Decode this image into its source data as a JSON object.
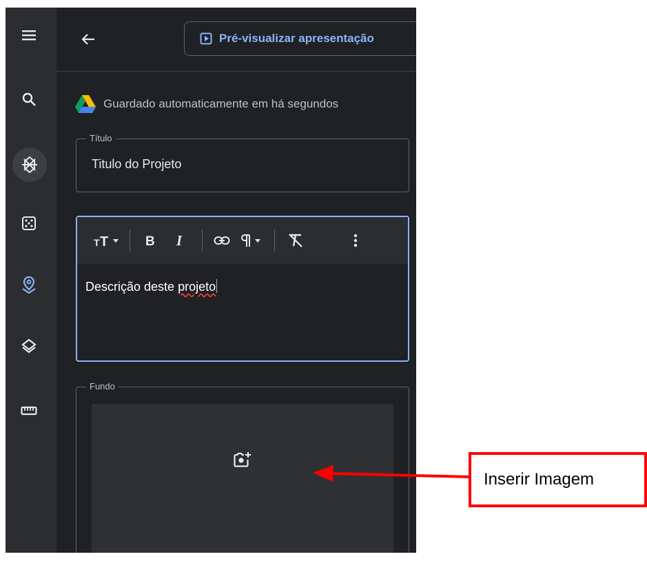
{
  "topbar": {
    "preview_label": "Pré-visualizar apresentação"
  },
  "status": {
    "saved_text": "Guardado automaticamente em há segundos"
  },
  "title_field": {
    "label": "Título",
    "value": "Titulo do Projeto"
  },
  "description": {
    "text_before": "Descrição deste ",
    "misspelled_word": "projeto"
  },
  "background_field": {
    "label": "Fundo"
  },
  "annotation": {
    "callout_text": "Inserir Imagem",
    "color": "#ff0000"
  },
  "icons": {
    "rail": [
      "menu-icon",
      "search-icon",
      "layers-kml-icon",
      "dice-icon",
      "location-pin-icon",
      "layers-icon",
      "ruler-icon"
    ],
    "toolbar": [
      "text-size-icon",
      "bold-icon",
      "italic-icon",
      "link-icon",
      "paragraph-icon",
      "clear-format-icon",
      "more-vert-icon"
    ]
  },
  "colors": {
    "panel_bg": "#202124",
    "rail_bg": "#2c2d30",
    "accent": "#8ab4f8",
    "pin_blue": "#8ab4f8"
  }
}
